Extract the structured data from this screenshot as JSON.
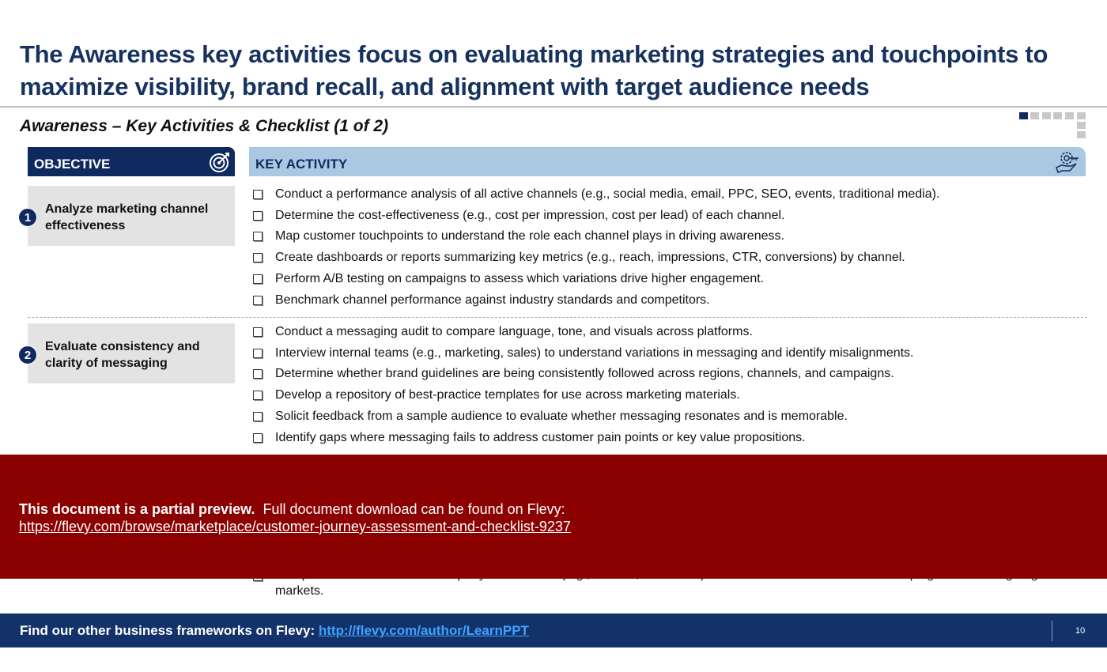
{
  "title": "The Awareness key activities focus on evaluating marketing strategies and touchpoints to maximize visibility, brand recall, and alignment with target audience needs",
  "subtitle": "Awareness – Key Activities & Checklist (1 of 2)",
  "pager": {
    "current": 1,
    "total": 6
  },
  "headers": {
    "objective": "OBJECTIVE",
    "activity": "KEY ACTIVITY",
    "objective_icon": "target-icon",
    "activity_icon": "hand-gear-key-icon"
  },
  "sections": [
    {
      "number": "1",
      "objective": "Analyze marketing channel effectiveness",
      "items": [
        "Conduct a performance analysis of all active channels (e.g., social media, email, PPC, SEO, events, traditional media).",
        "Determine the cost-effectiveness (e.g., cost per impression, cost per lead) of each channel.",
        "Map customer touchpoints to understand the role each channel plays in driving awareness.",
        "Create dashboards or reports summarizing key metrics (e.g., reach, impressions, CTR, conversions) by channel.",
        "Perform A/B testing on campaigns to assess which variations drive higher engagement.",
        "Benchmark channel performance against industry standards and competitors."
      ]
    },
    {
      "number": "2",
      "objective": "Evaluate consistency and clarity of messaging",
      "items": [
        "Conduct a messaging audit to compare language, tone, and visuals across platforms.",
        "Interview internal teams (e.g., marketing, sales) to understand variations in messaging and identify misalignments.",
        "Determine whether brand guidelines are being consistently followed across regions, channels, and campaigns.",
        "Develop a repository of best-practice templates for use across marketing materials.",
        "Solicit feedback from a sample audience to evaluate whether messaging resonates and is memorable.",
        "Identify gaps where messaging fails to address customer pain points or key value propositions."
      ]
    }
  ],
  "hidden_item": "Compare customer data to third-party benchmarks (e.g., Nielsen, Comscore) to evaluate the effectiveness of campaigns in reaching target markets.",
  "overlay": {
    "bold": "This document is a partial preview.",
    "text": "Full document download can be found on Flevy:",
    "link": "https://flevy.com/browse/marketplace/customer-journey-assessment-and-checklist-9237"
  },
  "footer": {
    "text": "Find our other business frameworks on Flevy:",
    "link": "http://flevy.com/author/LearnPPT",
    "page": "10"
  },
  "colors": {
    "navy": "#0f2a5e",
    "light_blue": "#a9c9e2",
    "preview_red": "#8b0000"
  }
}
